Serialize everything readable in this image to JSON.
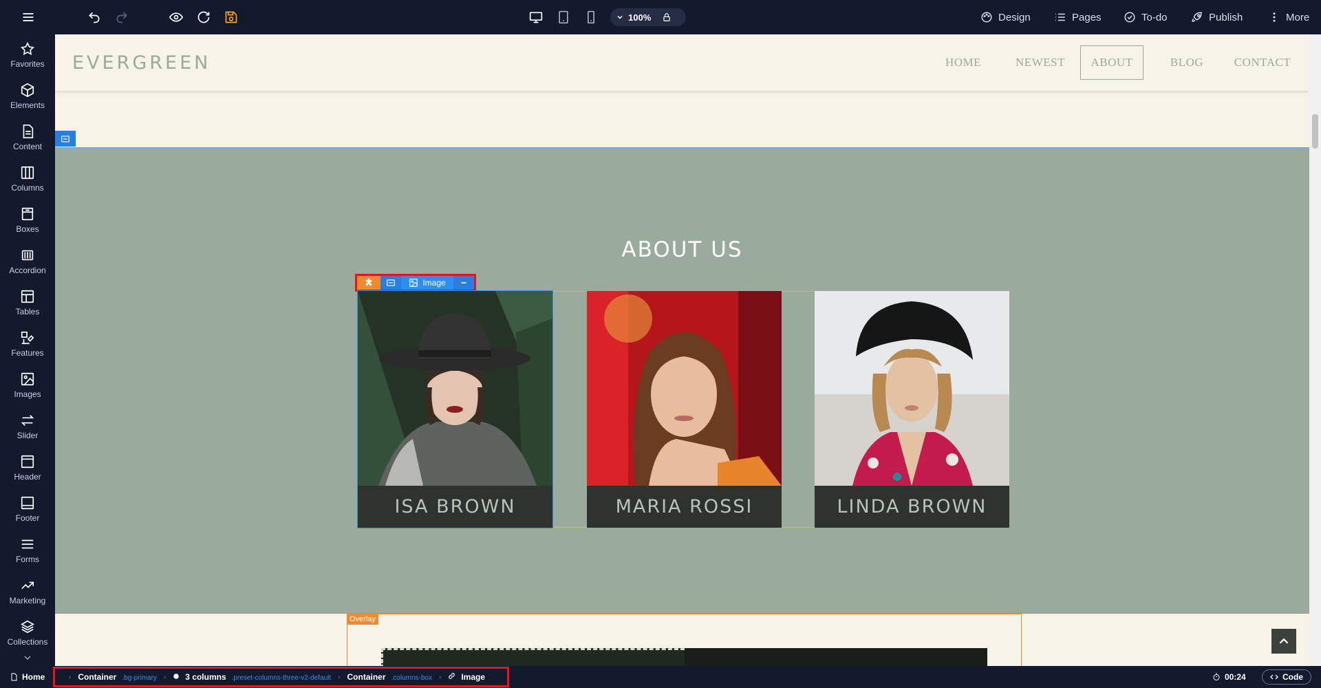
{
  "toolbar": {
    "zoom": "100%",
    "design_label": "Design",
    "pages_label": "Pages",
    "todo_label": "To-do",
    "publish_label": "Publish",
    "more_label": "More"
  },
  "sidebar": {
    "items": [
      {
        "label": "Favorites",
        "icon": "star-icon"
      },
      {
        "label": "Elements",
        "icon": "cube-icon"
      },
      {
        "label": "Content",
        "icon": "document-icon"
      },
      {
        "label": "Columns",
        "icon": "columns-icon"
      },
      {
        "label": "Boxes",
        "icon": "box-icon"
      },
      {
        "label": "Accordion",
        "icon": "accordion-icon"
      },
      {
        "label": "Tables",
        "icon": "table-icon"
      },
      {
        "label": "Features",
        "icon": "shapes-icon"
      },
      {
        "label": "Images",
        "icon": "image-icon"
      },
      {
        "label": "Slider",
        "icon": "arrows-icon"
      },
      {
        "label": "Header",
        "icon": "header-icon"
      },
      {
        "label": "Footer",
        "icon": "footer-icon"
      },
      {
        "label": "Forms",
        "icon": "list-icon"
      },
      {
        "label": "Marketing",
        "icon": "trend-icon"
      },
      {
        "label": "Collections",
        "icon": "layers-icon"
      }
    ]
  },
  "site": {
    "logo": "EVERGREEN",
    "nav": [
      "HOME",
      "NEWEST",
      "ABOUT",
      "BLOG",
      "CONTACT"
    ],
    "active_nav": "ABOUT",
    "about_title": "ABOUT US",
    "cards": [
      {
        "name": "ISA BROWN"
      },
      {
        "name": "MARIA ROSSI"
      },
      {
        "name": "LINDA BROWN"
      }
    ],
    "overlay_label": "Overlay"
  },
  "element_toolbar": {
    "image_label": "Image"
  },
  "breadcrumb": {
    "home": "Home",
    "items": [
      {
        "label": "Container",
        "cls": ".bg-primary"
      },
      {
        "label": "3 columns",
        "cls": ".preset-columns-three-v2-default"
      },
      {
        "label": "Container",
        "cls": ".columns-box"
      },
      {
        "label": "Image",
        "cls": ""
      }
    ]
  },
  "status": {
    "timer": "00:24",
    "code_label": "Code"
  },
  "colors": {
    "app_bg": "#141a2e",
    "canvas_bg": "#f7f3e8",
    "section_bg": "#9aab9d",
    "accent_blue": "#2a7fde",
    "accent_orange": "#f08a2c",
    "highlight_red": "#e3161e"
  }
}
